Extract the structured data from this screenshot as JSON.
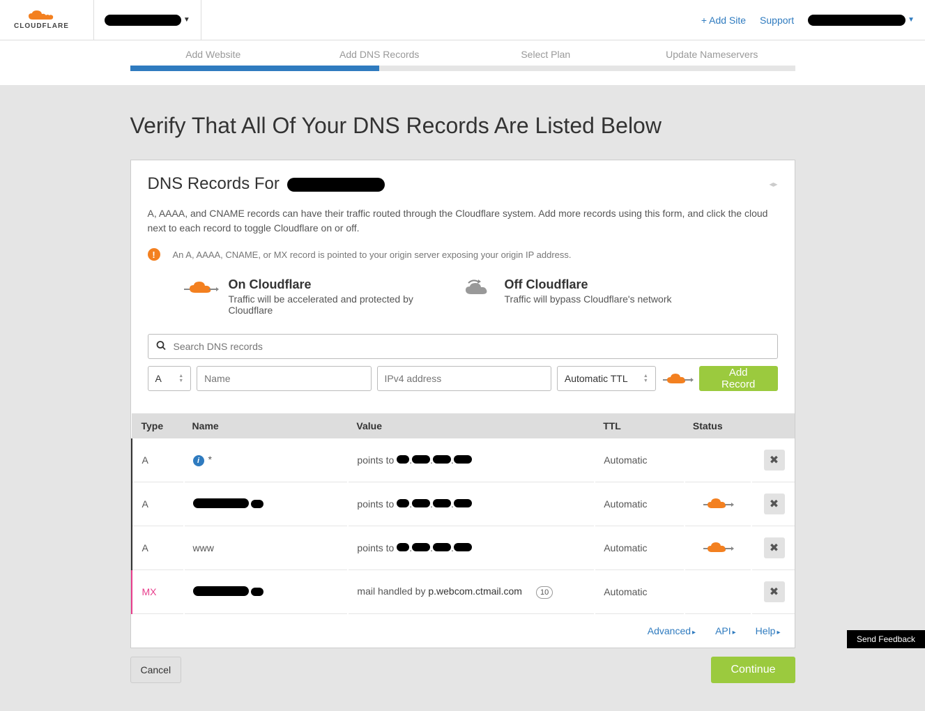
{
  "header": {
    "logo_text": "CLOUDFLARE",
    "add_site": "+ Add Site",
    "support": "Support"
  },
  "steps": {
    "items": [
      "Add Website",
      "Add DNS Records",
      "Select Plan",
      "Update Nameservers"
    ],
    "progress_pct": 37.5
  },
  "page_title": "Verify That All Of Your DNS Records Are Listed Below",
  "card": {
    "title_prefix": "DNS Records For",
    "description": "A, AAAA, and CNAME records can have their traffic routed through the Cloudflare system. Add more records using this form, and click the cloud next to each record to toggle Cloudflare on or off.",
    "alert": "An A, AAAA, CNAME, or MX record is pointed to your origin server exposing your origin IP address.",
    "legend": {
      "on_title": "On Cloudflare",
      "on_desc": "Traffic will be accelerated and protected by Cloudflare",
      "off_title": "Off Cloudflare",
      "off_desc": "Traffic will bypass Cloudflare's network"
    }
  },
  "search": {
    "placeholder": "Search DNS records"
  },
  "form": {
    "type_value": "A",
    "name_placeholder": "Name",
    "value_placeholder": "IPv4 address",
    "ttl_value": "Automatic TTL",
    "add_label": "Add Record"
  },
  "table": {
    "headers": {
      "type": "Type",
      "name": "Name",
      "value": "Value",
      "ttl": "TTL",
      "status": "Status"
    },
    "rows": [
      {
        "type": "A",
        "name": "*",
        "name_redacted": false,
        "info": true,
        "value_prefix": "points to",
        "value_redacted": true,
        "value_text": "",
        "ttl": "Automatic",
        "status": "none"
      },
      {
        "type": "A",
        "name": "",
        "name_redacted": true,
        "info": false,
        "value_prefix": "points to",
        "value_redacted": true,
        "value_text": "",
        "ttl": "Automatic",
        "status": "on"
      },
      {
        "type": "A",
        "name": "www",
        "name_redacted": false,
        "info": false,
        "value_prefix": "points to",
        "value_redacted": true,
        "value_text": "",
        "ttl": "Automatic",
        "status": "on"
      },
      {
        "type": "MX",
        "name": "",
        "name_redacted": true,
        "info": false,
        "value_prefix": "mail handled by",
        "value_redacted": false,
        "value_text": "p.webcom.ctmail.com",
        "priority": "10",
        "ttl": "Automatic",
        "status": "none"
      }
    ]
  },
  "footer_links": {
    "advanced": "Advanced",
    "api": "API",
    "help": "Help"
  },
  "actions": {
    "cancel": "Cancel",
    "continue": "Continue"
  },
  "feedback": "Send Feedback"
}
